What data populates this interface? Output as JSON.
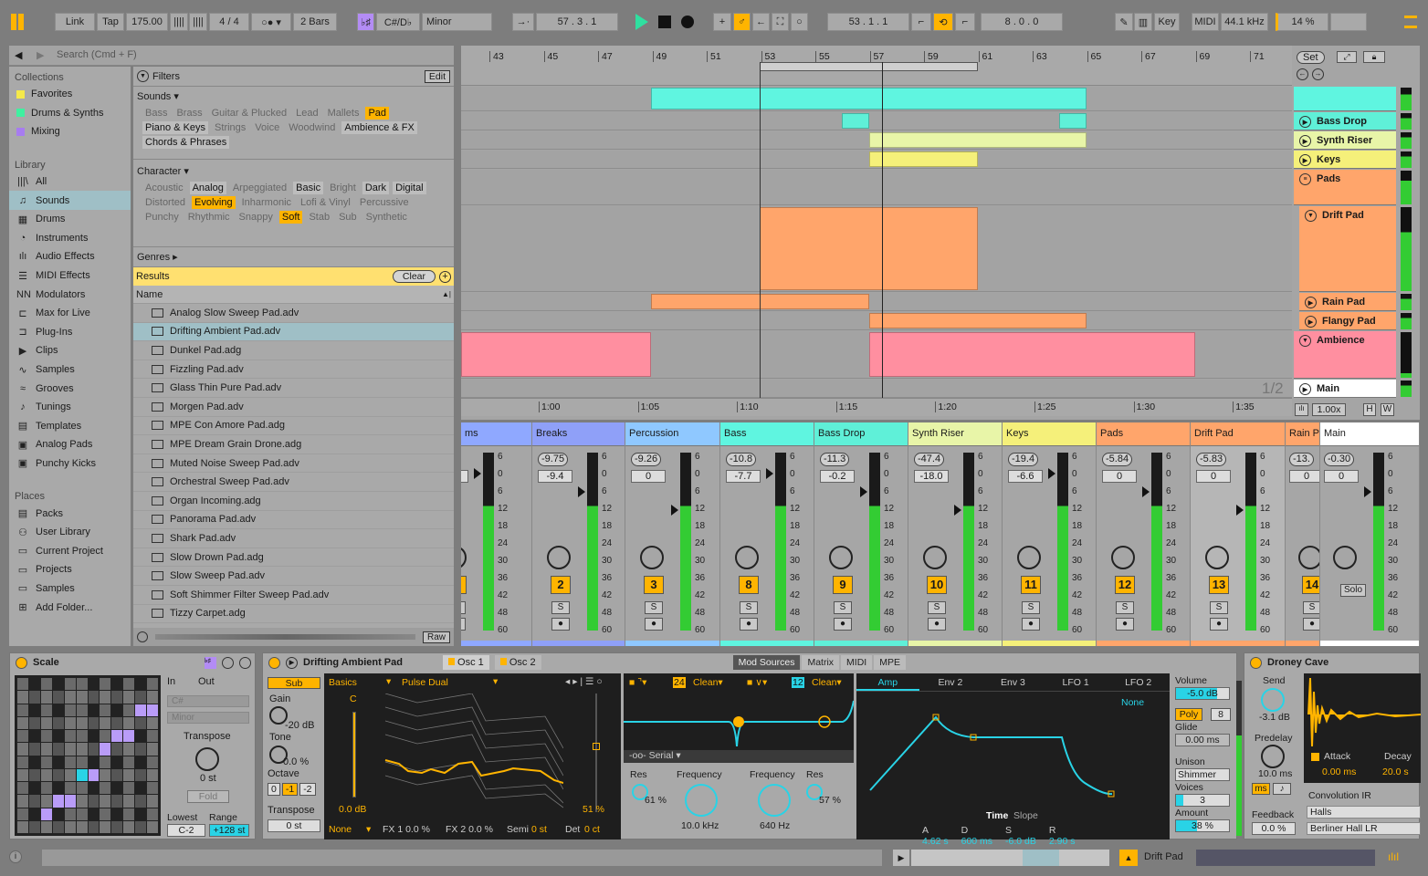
{
  "transport": {
    "link": "Link",
    "tap": "Tap",
    "tempo": "175.00",
    "signature": "4 / 4",
    "quantize": "2 Bars",
    "scale_root": "C#/D♭",
    "scale_mode": "Minor",
    "position": "57 .  3 .  1",
    "loop_start": "53 .  1 .  1",
    "loop_length": "8 .  0 .  0",
    "key": "Key",
    "midi": "MIDI",
    "sample_rate": "44.1 kHz",
    "cpu": "14 %"
  },
  "browser": {
    "search_placeholder": "Search (Cmd + F)",
    "collections_header": "Collections",
    "collections": [
      {
        "label": "Favorites",
        "color": "#f5e94a"
      },
      {
        "label": "Drums & Synths",
        "color": "#3ff0a0"
      },
      {
        "label": "Mixing",
        "color": "#a77cf0"
      }
    ],
    "library_header": "Library",
    "library": [
      {
        "label": "All",
        "icon": "|||\\"
      },
      {
        "label": "Sounds",
        "icon": "♫",
        "selected": true
      },
      {
        "label": "Drums",
        "icon": "▦"
      },
      {
        "label": "Instruments",
        "icon": "◔"
      },
      {
        "label": "Audio Effects",
        "icon": "ılı"
      },
      {
        "label": "MIDI Effects",
        "icon": "☰"
      },
      {
        "label": "Modulators",
        "icon": "NN"
      },
      {
        "label": "Max for Live",
        "icon": "⊏"
      },
      {
        "label": "Plug-Ins",
        "icon": "⊐"
      },
      {
        "label": "Clips",
        "icon": "▶"
      },
      {
        "label": "Samples",
        "icon": "∿"
      },
      {
        "label": "Grooves",
        "icon": "≈"
      },
      {
        "label": "Tunings",
        "icon": "♪"
      },
      {
        "label": "Templates",
        "icon": "▤"
      },
      {
        "label": "Analog Pads",
        "icon": "▣"
      },
      {
        "label": "Punchy Kicks",
        "icon": "▣"
      }
    ],
    "places_header": "Places",
    "places": [
      {
        "label": "Packs",
        "icon": "▤"
      },
      {
        "label": "User Library",
        "icon": "⚇"
      },
      {
        "label": "Current Project",
        "icon": "▭"
      },
      {
        "label": "Projects",
        "icon": "▭"
      },
      {
        "label": "Samples",
        "icon": "▭"
      },
      {
        "label": "Add Folder...",
        "icon": "⊞"
      }
    ],
    "filters_label": "Filters",
    "edit_label": "Edit",
    "sounds_label": "Sounds ▾",
    "sounds_tags": [
      {
        "t": "Bass"
      },
      {
        "t": "Brass"
      },
      {
        "t": "Guitar & Plucked"
      },
      {
        "t": "Lead"
      },
      {
        "t": "Mallets"
      },
      {
        "t": "Pad",
        "s": "sel"
      },
      {
        "t": "Piano & Keys",
        "s": "on"
      },
      {
        "t": "Strings"
      },
      {
        "t": "Voice"
      },
      {
        "t": "Woodwind"
      },
      {
        "t": "Ambience & FX",
        "s": "on"
      },
      {
        "t": "Chords & Phrases",
        "s": "on"
      }
    ],
    "character_label": "Character ▾",
    "character_tags": [
      {
        "t": "Acoustic"
      },
      {
        "t": "Analog",
        "s": "on"
      },
      {
        "t": "Arpeggiated"
      },
      {
        "t": "Basic",
        "s": "on"
      },
      {
        "t": "Bright"
      },
      {
        "t": "Dark",
        "s": "on"
      },
      {
        "t": "Digital",
        "s": "on"
      },
      {
        "t": "Distorted"
      },
      {
        "t": "Evolving",
        "s": "sel"
      },
      {
        "t": "Inharmonic"
      },
      {
        "t": "Lofi & Vinyl"
      },
      {
        "t": "Percussive"
      },
      {
        "t": "Punchy"
      },
      {
        "t": "Rhythmic"
      },
      {
        "t": "Snappy"
      },
      {
        "t": "Soft",
        "s": "sel"
      },
      {
        "t": "Stab"
      },
      {
        "t": "Sub"
      },
      {
        "t": "Synthetic"
      }
    ],
    "genres_label": "Genres ▸",
    "results_label": "Results",
    "clear_label": "Clear",
    "name_header": "Name",
    "results": [
      {
        "n": "Analog Slow Sweep Pad.adv"
      },
      {
        "n": "Drifting Ambient Pad.adv",
        "sel": true
      },
      {
        "n": "Dunkel Pad.adg"
      },
      {
        "n": "Fizzling Pad.adv"
      },
      {
        "n": "Glass Thin Pure Pad.adv"
      },
      {
        "n": "Morgen Pad.adv"
      },
      {
        "n": "MPE Con Amore Pad.adg"
      },
      {
        "n": "MPE Dream Grain Drone.adg"
      },
      {
        "n": "Muted Noise Sweep Pad.adv"
      },
      {
        "n": "Orchestral Sweep Pad.adv"
      },
      {
        "n": "Organ Incoming.adg"
      },
      {
        "n": "Panorama Pad.adv"
      },
      {
        "n": "Shark Pad.adv"
      },
      {
        "n": "Slow Drown Pad.adg"
      },
      {
        "n": "Slow Sweep Pad.adv"
      },
      {
        "n": "Soft Shimmer Filter Sweep Pad.adv"
      },
      {
        "n": "Tizzy Carpet.adg"
      }
    ],
    "raw_label": "Raw"
  },
  "arrangement": {
    "bars": [
      "43",
      "45",
      "47",
      "49",
      "51",
      "53",
      "55",
      "57",
      "59",
      "61",
      "63",
      "65",
      "67",
      "69",
      "71"
    ],
    "times": [
      "1:00",
      "1:05",
      "1:10",
      "1:15",
      "1:20",
      "1:25",
      "1:30",
      "1:35"
    ],
    "set_label": "Set",
    "zoom": "1.00x",
    "h_label": "H",
    "w_label": "W",
    "page": "1/2",
    "tracks": [
      {
        "name": "",
        "color": "#5ff5e0"
      },
      {
        "name": "Bass Drop",
        "color": "#5ff0d8"
      },
      {
        "name": "Synth Riser",
        "color": "#e8f5a8"
      },
      {
        "name": "Keys",
        "color": "#f5f07a"
      },
      {
        "name": "Pads",
        "color": "#ffa56b"
      },
      {
        "name": "Drift Pad",
        "color": "#ffa56b"
      },
      {
        "name": "Rain Pad",
        "color": "#ffa56b"
      },
      {
        "name": "Flangy Pad",
        "color": "#ffa56b"
      },
      {
        "name": "Ambience",
        "color": "#ff8fa0"
      },
      {
        "name": "Main",
        "color": "#ffffff"
      }
    ]
  },
  "mixer": {
    "scale": [
      "6",
      "0",
      "6",
      "12",
      "18",
      "24",
      "30",
      "36",
      "42",
      "48",
      "60"
    ],
    "solo": "Solo",
    "S": "S",
    "strips": [
      {
        "name": "ms",
        "color": "#8fa8ff",
        "vol": "31",
        "pan": ".0",
        "num": "1"
      },
      {
        "name": "Breaks",
        "color": "#8fa0f8",
        "vol": "-9.75",
        "pan": "-9.4",
        "num": "2"
      },
      {
        "name": "Percussion",
        "color": "#8fc8ff",
        "vol": "-9.26",
        "pan": "0",
        "num": "3"
      },
      {
        "name": "Bass",
        "color": "#5ff5e0",
        "vol": "-10.8",
        "pan": "-7.7",
        "num": "8"
      },
      {
        "name": "Bass Drop",
        "color": "#5ff0d8",
        "vol": "-11.3",
        "pan": "-0.2",
        "num": "9"
      },
      {
        "name": "Synth Riser",
        "color": "#e8f5a8",
        "vol": "-47.4",
        "pan": "-18.0",
        "num": "10"
      },
      {
        "name": "Keys",
        "color": "#f5f07a",
        "vol": "-19.4",
        "pan": "-6.6",
        "num": "11"
      },
      {
        "name": "Pads",
        "color": "#ffa56b",
        "vol": "-5.84",
        "pan": "0",
        "num": "12"
      },
      {
        "name": "Drift Pad",
        "color": "#ffa56b",
        "vol": "-5.83",
        "pan": "0",
        "num": "13"
      },
      {
        "name": "Rain P",
        "color": "#ffa56b",
        "vol": "-13.",
        "pan": "0",
        "num": "14"
      },
      {
        "name": "Main",
        "color": "#ffffff",
        "vol": "-0.30",
        "pan": "0",
        "num": ""
      }
    ]
  },
  "scale_device": {
    "title": "Scale",
    "in": "In",
    "out": "Out",
    "root": "C#",
    "mode": "Minor",
    "transpose_label": "Transpose",
    "transpose": "0 st",
    "fold": "Fold",
    "lowest_label": "Lowest",
    "range_label": "Range",
    "lowest": "C-2",
    "range": "+128 st"
  },
  "wavetable": {
    "title": "Drifting Ambient Pad",
    "osc1": "Osc 1",
    "osc2": "Osc 2",
    "sub": "Sub",
    "gain_label": "Gain",
    "gain": "-20 dB",
    "tone_label": "Tone",
    "tone": "0.0 %",
    "octave_label": "Octave",
    "octaves": [
      "0",
      "-1",
      "-2"
    ],
    "transpose_label": "Transpose",
    "transpose": "0 st",
    "category": "Basics",
    "table": "Pulse Dual",
    "note": "C",
    "level": "0.0 dB",
    "position": "51 %",
    "fx_mode": "None",
    "fx1": "FX 1 0.0 %",
    "fx2": "FX 2 0.0 %",
    "semi_label": "Semi",
    "semi": "0 st",
    "det_label": "Det",
    "det": "0 ct",
    "filter1_slope": "24",
    "filter1_type": "Clean▾",
    "filter2_slope": "12",
    "filter2_type": "Clean▾",
    "routing": "Serial",
    "res1_label": "Res",
    "res1": "61 %",
    "freq1_label": "Frequency",
    "freq1": "10.0 kHz",
    "freq2_label": "Frequency",
    "freq2": "640 Hz",
    "res2_label": "Res",
    "res2": "57 %",
    "mod_tabs": [
      "Mod Sources",
      "Matrix",
      "MIDI",
      "MPE"
    ],
    "env_tabs": [
      "Amp",
      "Env 2",
      "Env 3",
      "LFO 1",
      "LFO 2"
    ],
    "env_target": "None",
    "time_label": "Time",
    "slope_label": "Slope",
    "adsr": [
      {
        "k": "A",
        "v": "4.62 s"
      },
      {
        "k": "D",
        "v": "600 ms"
      },
      {
        "k": "S",
        "v": "-6.0 dB"
      },
      {
        "k": "R",
        "v": "2.90 s"
      }
    ],
    "volume_label": "Volume",
    "volume": "-5.0 dB",
    "poly": "Poly",
    "voices_n": "8",
    "glide_label": "Glide",
    "glide": "0.00 ms",
    "unison_label": "Unison",
    "unison": "Shimmer",
    "voices_label": "Voices",
    "voices": "3",
    "amount_label": "Amount",
    "amount": "38 %"
  },
  "reverb": {
    "title": "Droney Cave",
    "send_label": "Send",
    "send": "-3.1 dB",
    "predelay_label": "Predelay",
    "predelay": "10.0 ms",
    "ms": "ms",
    "feedback_label": "Feedback",
    "feedback": "0.0 %",
    "attack_label": "Attack",
    "decay_label": "Decay",
    "attack": "0.00 ms",
    "decay": "20.0 s",
    "ir_label": "Convolution IR",
    "ir_category": "Halls",
    "ir": "Berliner Hall LR"
  },
  "status": {
    "track": "Drift Pad"
  }
}
